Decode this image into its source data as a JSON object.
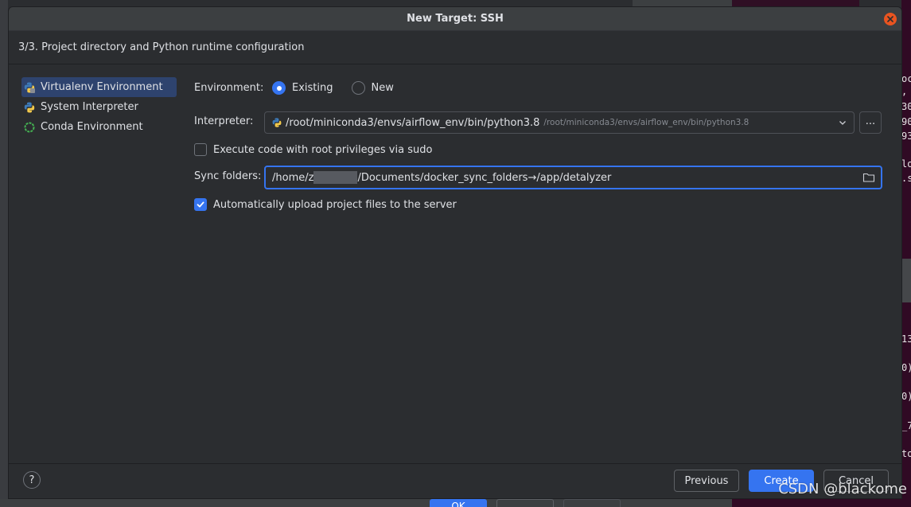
{
  "dialog": {
    "title": "New Target: SSH",
    "step_header": "3/3. Project directory and Python runtime configuration"
  },
  "sidebar": {
    "items": [
      {
        "label": "Virtualenv Environment",
        "icon": "python-virtualenv-icon",
        "selected": true
      },
      {
        "label": "System Interpreter",
        "icon": "python-icon",
        "selected": false
      },
      {
        "label": "Conda Environment",
        "icon": "conda-icon",
        "selected": false
      }
    ]
  },
  "form": {
    "environment_label": "Environment:",
    "environment_options": [
      {
        "label": "Existing",
        "selected": true
      },
      {
        "label": "New",
        "selected": false
      }
    ],
    "interpreter_label": "Interpreter:",
    "interpreter_path": "/root/miniconda3/envs/airflow_env/bin/python3.8",
    "interpreter_path_dim": "/root/miniconda3/envs/airflow_env/bin/python3.8",
    "browse_label": "...",
    "sudo_label": "Execute code with root privileges via sudo",
    "sudo_checked": false,
    "sync_label": "Sync folders:",
    "sync_prefix": "/home/z",
    "sync_suffix": "/Documents/docker_sync_folders→/app/detalyzer",
    "upload_label": "Automatically upload project files to the server",
    "upload_checked": true
  },
  "footer": {
    "help_label": "?",
    "previous_label": "Previous",
    "create_label": "Create",
    "cancel_label": "Cancel"
  },
  "background": {
    "under_ok_label": "OK"
  },
  "terminal": {
    "lines": [
      "oc",
      ",",
      "30",
      "90",
      "93",
      "lo",
      ".s",
      "13",
      "0)",
      "0)",
      "_7",
      "to"
    ]
  },
  "watermark": "CSDN @blackome",
  "colors": {
    "accent": "#3574f0",
    "dialog_bg": "#2b2d30",
    "titlebar_bg": "#3c3f41",
    "close": "#e95420",
    "selection": "#2e436e"
  }
}
